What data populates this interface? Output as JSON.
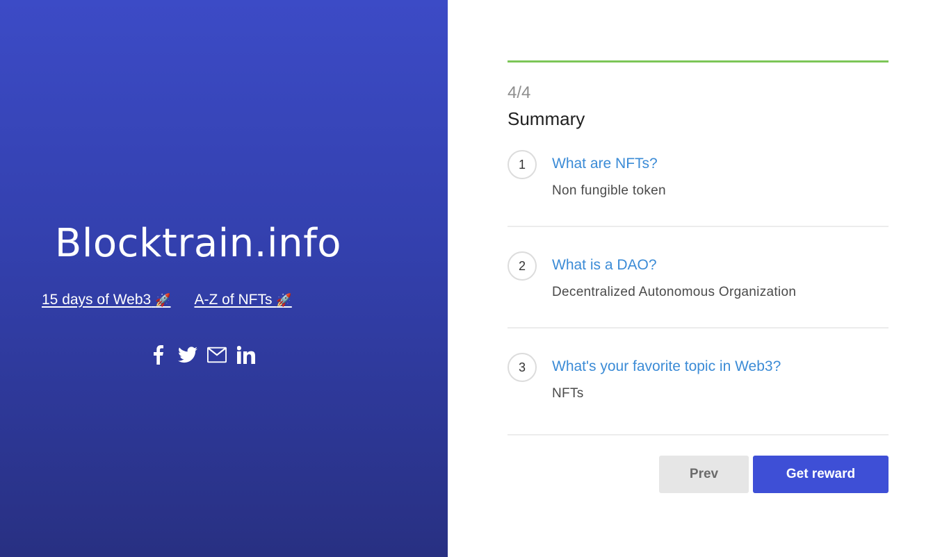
{
  "sidebar": {
    "title": "Blocktrain.info",
    "links": [
      {
        "label": "15 days of Web3",
        "emoji": "🚀"
      },
      {
        "label": "A-Z of NFTs",
        "emoji": "🚀"
      }
    ],
    "social_icons": [
      "facebook-icon",
      "twitter-icon",
      "mail-icon",
      "linkedin-icon"
    ]
  },
  "quiz": {
    "progress_percent": 100,
    "progress_color": "#7cc657",
    "step": "4/4",
    "section_title": "Summary",
    "items": [
      {
        "number": "1",
        "question": "What are NFTs?",
        "answer": "Non fungible token"
      },
      {
        "number": "2",
        "question": "What is a DAO?",
        "answer": "Decentralized Autonomous Organization"
      },
      {
        "number": "3",
        "question": "What's your favorite topic in Web3?",
        "answer": "NFTs"
      }
    ],
    "buttons": {
      "prev": "Prev",
      "reward": "Get reward"
    }
  },
  "colors": {
    "sidebar_gradient_top": "#3c4bc6",
    "sidebar_gradient_bottom": "#283082",
    "link_blue": "#3b8bd6",
    "primary_button": "#3e4fd6"
  }
}
